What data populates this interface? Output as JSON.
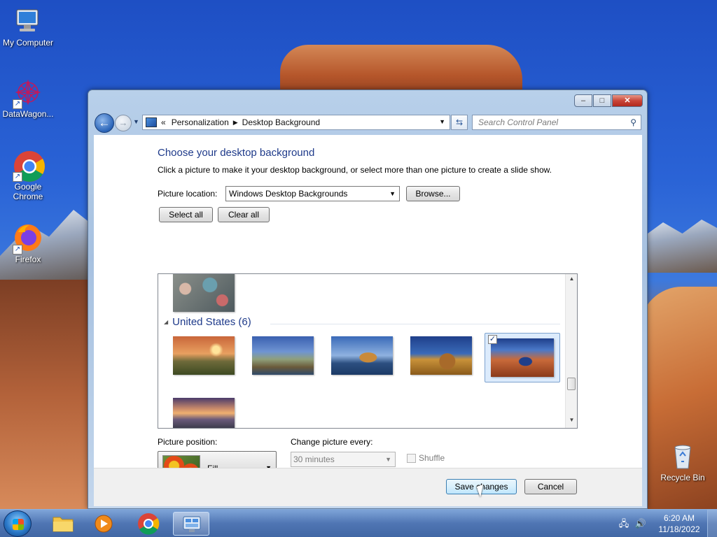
{
  "desktop": {
    "icons": [
      {
        "label": "My Computer",
        "icon": "computer-icon"
      },
      {
        "label": "DataWagon...",
        "icon": "datawagon-icon"
      },
      {
        "label": "Google Chrome",
        "icon": "chrome-icon"
      },
      {
        "label": "Firefox",
        "icon": "firefox-icon"
      },
      {
        "label": "Recycle Bin",
        "icon": "recycle-bin-icon"
      }
    ]
  },
  "window": {
    "controls": {
      "minimize": "–",
      "maximize": "□",
      "close": "✕"
    },
    "address": {
      "prefix": "«",
      "crumbs": [
        "Personalization",
        "Desktop Background"
      ]
    },
    "search": {
      "placeholder": "Search Control Panel"
    },
    "title": "Choose your desktop background",
    "description": "Click a picture to make it your desktop background, or select more than one picture to create a slide show.",
    "picture_location": {
      "label": "Picture location:",
      "value": "Windows Desktop Backgrounds",
      "browse": "Browse..."
    },
    "select_all": "Select all",
    "clear_all": "Clear all",
    "gallery": {
      "group": "United States (6)",
      "images": [
        {
          "name": "meadow-sunset",
          "selected": false
        },
        {
          "name": "lighthouse",
          "selected": false
        },
        {
          "name": "sea-rock",
          "selected": false
        },
        {
          "name": "hay-bale",
          "selected": false
        },
        {
          "name": "delicate-arch",
          "selected": true
        },
        {
          "name": "lake-sunset",
          "selected": false
        }
      ]
    },
    "picture_position": {
      "label": "Picture position:",
      "value": "Fill"
    },
    "change_every": {
      "label": "Change picture every:",
      "value": "30 minutes"
    },
    "shuffle": "Shuffle",
    "save": "Save changes",
    "cancel": "Cancel"
  },
  "taskbar": {
    "time": "6:20 AM",
    "date": "11/18/2022"
  },
  "colors": {
    "accent": "#1e3a8a",
    "taskbar": "#4a78b8"
  }
}
